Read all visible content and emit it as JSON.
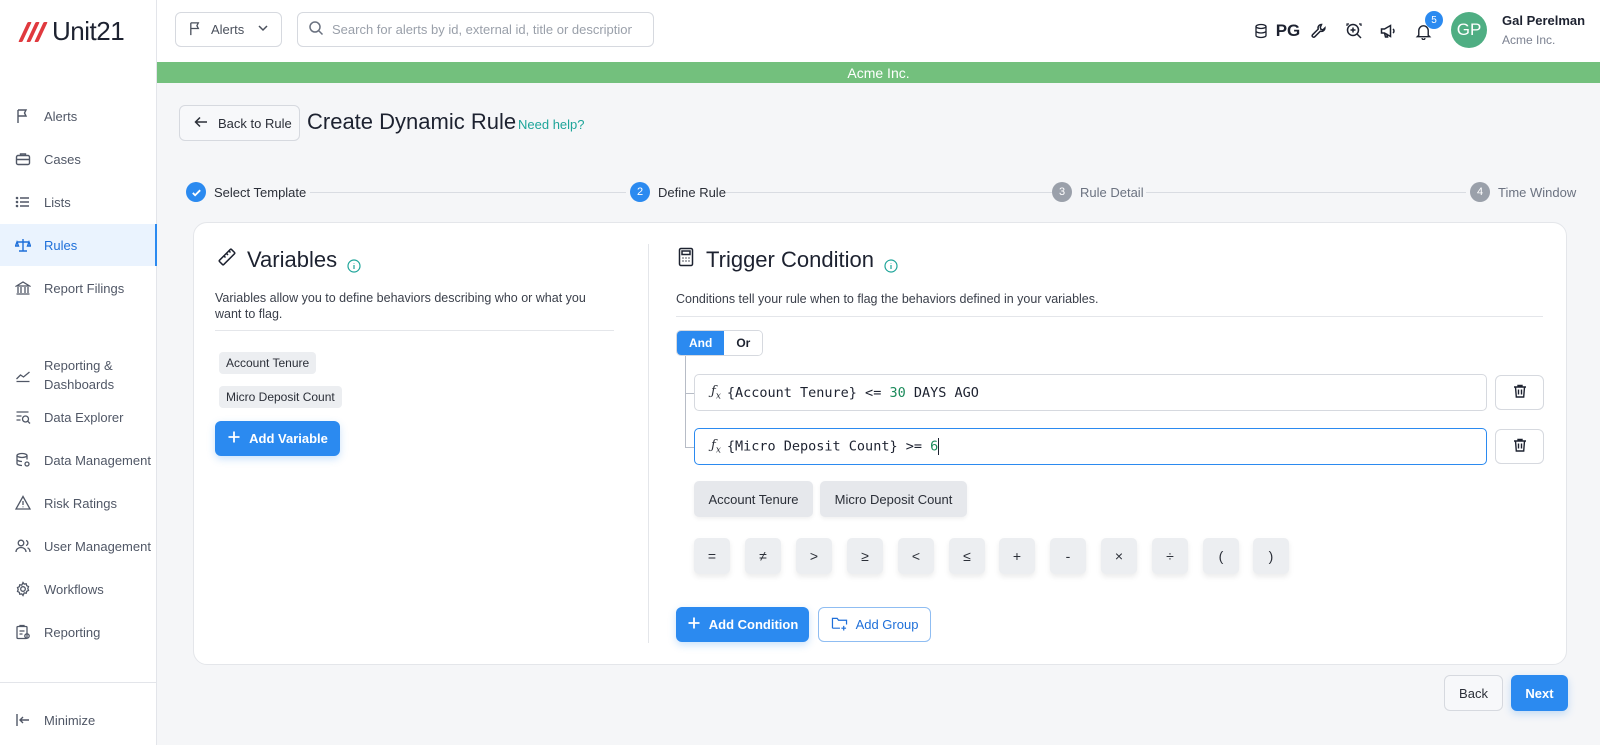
{
  "brand": {
    "logo_text": "Unit21",
    "logo_color": "#e0393e"
  },
  "sidebar": {
    "items": [
      {
        "label": "Alerts",
        "icon": "flag-icon"
      },
      {
        "label": "Cases",
        "icon": "briefcase-icon"
      },
      {
        "label": "Lists",
        "icon": "list-icon"
      },
      {
        "label": "Rules",
        "icon": "scale-icon",
        "active": true
      },
      {
        "label": "Report Filings",
        "icon": "bank-icon"
      },
      {
        "label": "Reporting & Dashboards",
        "icon": "chart-line-icon"
      },
      {
        "label": "Data Explorer",
        "icon": "data-search-icon"
      },
      {
        "label": "Data Management",
        "icon": "database-icon"
      },
      {
        "label": "Risk Ratings",
        "icon": "warning-icon"
      },
      {
        "label": "User Management",
        "icon": "users-icon"
      },
      {
        "label": "Workflows",
        "icon": "gear-icon"
      },
      {
        "label": "Reporting",
        "icon": "report-icon"
      }
    ],
    "minimize_label": "Minimize"
  },
  "topbar": {
    "module_select": "Alerts",
    "search_placeholder": "Search for alerts by id, external id, title or description",
    "datasource_label": "PG",
    "notification_count": "5",
    "user_initials": "GP",
    "user_name": "Gal Perelman",
    "user_org": "Acme Inc."
  },
  "org_banner": "Acme Inc.",
  "header": {
    "back_label": "Back to Rule",
    "title": "Create Dynamic Rule",
    "help_label": "Need help?"
  },
  "stepper": {
    "steps": [
      {
        "number": "1",
        "label": "Select Template",
        "state": "done"
      },
      {
        "number": "2",
        "label": "Define Rule",
        "state": "current"
      },
      {
        "number": "3",
        "label": "Rule Detail",
        "state": "todo"
      },
      {
        "number": "4",
        "label": "Time Window",
        "state": "todo"
      }
    ]
  },
  "variables": {
    "title": "Variables",
    "description": "Variables allow you to define behaviors describing who or what you want to flag.",
    "items": [
      "Account Tenure",
      "Micro Deposit Count"
    ],
    "add_label": "Add Variable"
  },
  "trigger": {
    "title": "Trigger Condition",
    "description": "Conditions tell your rule when to flag the behaviors defined in your variables.",
    "logic_options": [
      "And",
      "Or"
    ],
    "logic_selected": "And",
    "conditions": [
      {
        "prefix": "{Account Tenure} <= ",
        "number": "30",
        "suffix": " DAYS AGO"
      },
      {
        "prefix": "{Micro Deposit Count} >= ",
        "number": "6",
        "suffix": ""
      }
    ],
    "variable_buttons": [
      "Account Tenure",
      "Micro Deposit Count"
    ],
    "operators": [
      "=",
      "≠",
      ">",
      "≥",
      "<",
      "≤",
      "+",
      "-",
      "×",
      "÷",
      "(",
      ")"
    ],
    "add_condition_label": "Add Condition",
    "add_group_label": "Add Group"
  },
  "footer": {
    "back_label": "Back",
    "next_label": "Next"
  },
  "colors": {
    "primary": "#2b8af0",
    "banner": "#73c07d",
    "teal_link": "#1fa59a",
    "avatar": "#4fae83"
  }
}
